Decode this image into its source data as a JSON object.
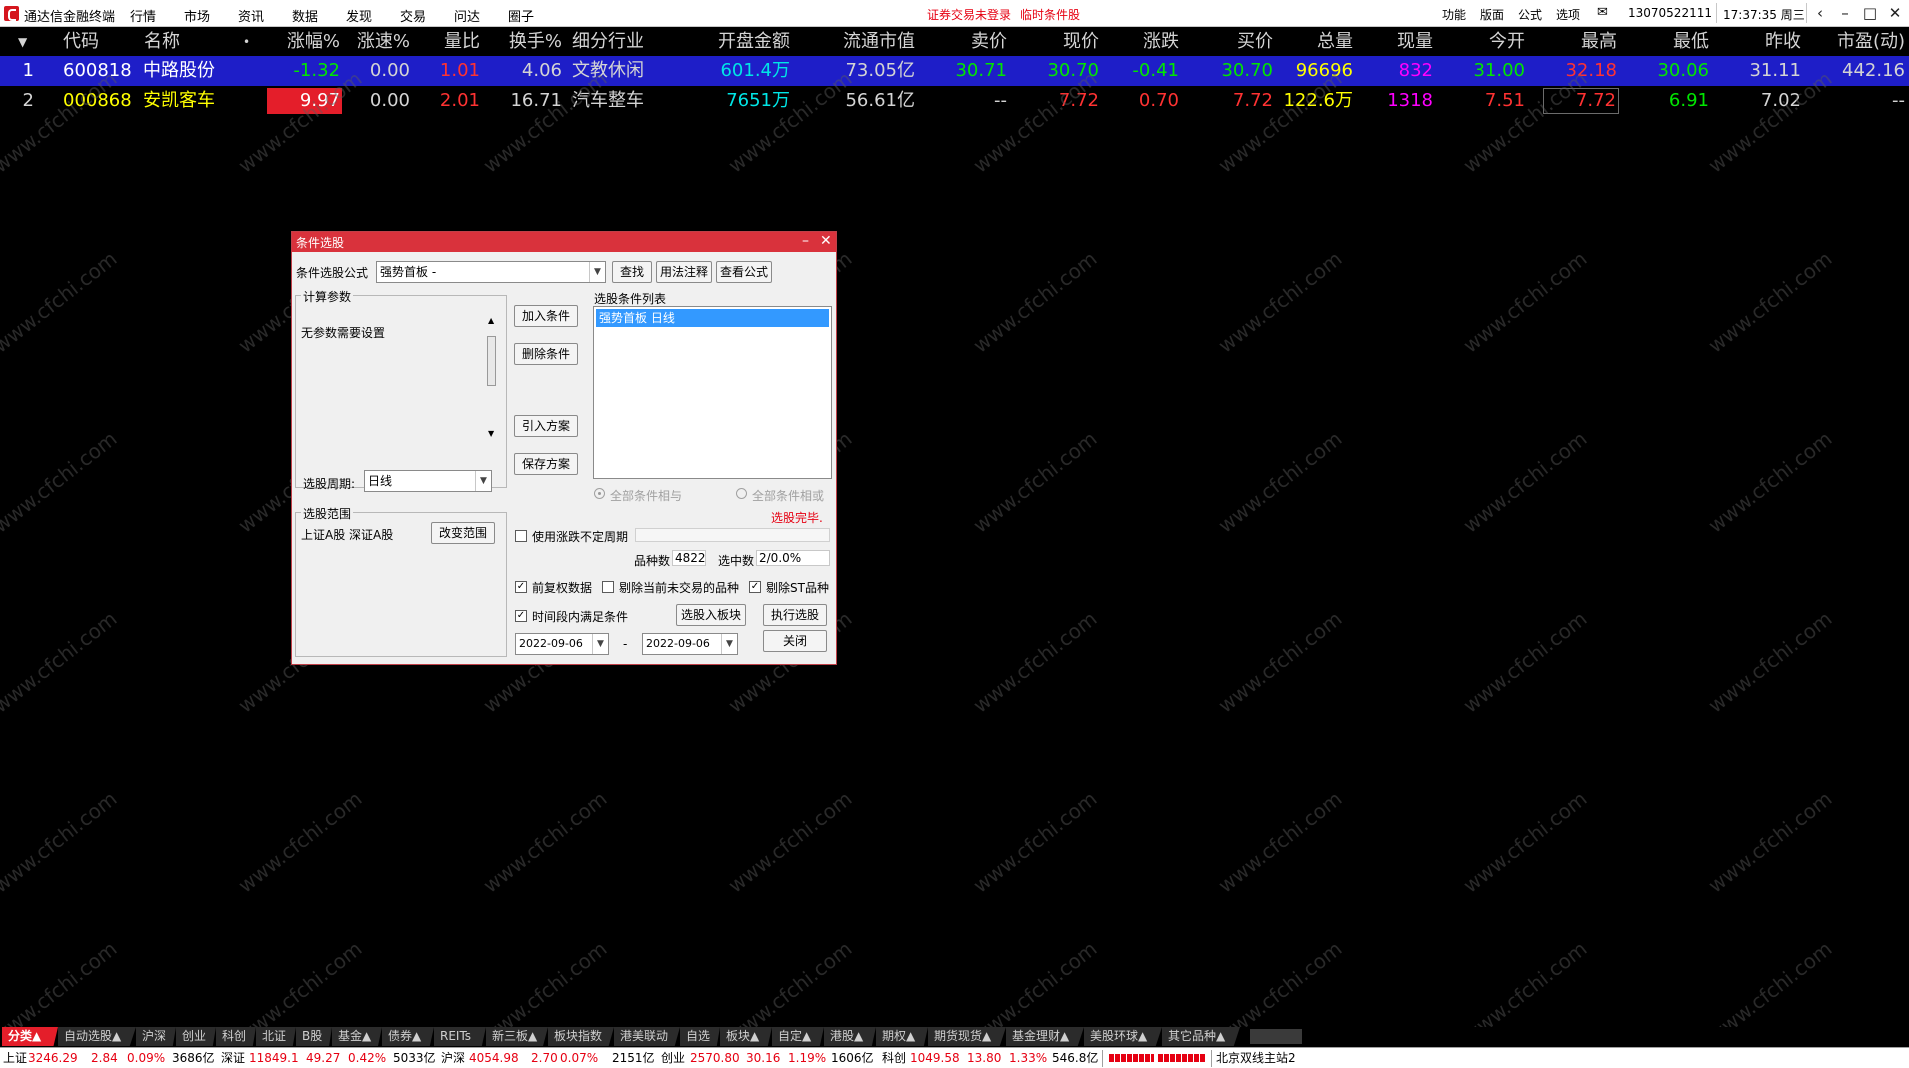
{
  "menubar": {
    "app_title": "通达信金融终端",
    "menus": [
      "行情",
      "市场",
      "资讯",
      "数据",
      "发现",
      "交易",
      "问达",
      "圈子"
    ],
    "notice_trade": "证券交易未登录",
    "notice_temp": "临时条件股",
    "right_items": [
      "功能",
      "版面",
      "公式",
      "选项"
    ],
    "account": "13070522111",
    "clock": "17:37:35 周三"
  },
  "table": {
    "headers": [
      "代码",
      "名称",
      "•",
      "涨幅%",
      "涨速%",
      "量比",
      "换手%",
      "细分行业",
      "开盘金额",
      "流通市值",
      "卖价",
      "现价",
      "涨跌",
      "买价",
      "总量",
      "现量",
      "今开",
      "最高",
      "最低",
      "昨收",
      "市盈(动)"
    ],
    "rows": [
      {
        "idx": "1",
        "code": "600818",
        "name": "中路股份",
        "chg_pct": "-1.32",
        "speed": "0.00",
        "vol_ratio": "1.01",
        "turnover": "4.06",
        "industry": "文教休闲",
        "open_amt": "601.4万",
        "float_cap": "73.05亿",
        "ask": "30.71",
        "price": "30.70",
        "chg": "-0.41",
        "bid": "30.70",
        "total_vol": "96696",
        "cur_vol": "832",
        "open": "31.00",
        "high": "32.18",
        "low": "30.06",
        "prev_close": "31.11",
        "pe": "442.16"
      },
      {
        "idx": "2",
        "code": "000868",
        "name": "安凯客车",
        "chg_pct": "9.97",
        "speed": "0.00",
        "vol_ratio": "2.01",
        "turnover": "16.71",
        "industry": "汽车整车",
        "open_amt": "7651万",
        "float_cap": "56.61亿",
        "ask": "--",
        "price": "7.72",
        "chg": "0.70",
        "bid": "7.72",
        "total_vol": "122.6万",
        "cur_vol": "1318",
        "open": "7.51",
        "high": "7.72",
        "low": "6.91",
        "prev_close": "7.02",
        "pe": "--"
      }
    ]
  },
  "watermark": "www.cfchi.com",
  "dialog": {
    "title": "条件选股",
    "formula_label": "条件选股公式",
    "formula_value": "强势首板    -",
    "find_btn": "查找",
    "usage_btn": "用法注释",
    "view_btn": "查看公式",
    "params_group": "计算参数",
    "no_params": "无参数需要设置",
    "period_label": "选股周期:",
    "period_value": "日线",
    "add_btn": "加入条件",
    "del_btn": "删除条件",
    "import_btn": "引入方案",
    "save_btn": "保存方案",
    "list_label": "选股条件列表",
    "list_items": [
      "强势首板  日线"
    ],
    "radio_and": "全部条件相与",
    "radio_or": "全部条件相或",
    "done": "选股完毕.",
    "scope_group": "选股范围",
    "scope_value": "上证A股 深证A股",
    "change_scope_btn": "改变范围",
    "use_period_label": "使用涨跌不定周期",
    "count_label": "品种数",
    "count_value": "4822",
    "hit_label": "选中数",
    "hit_value": "2/0.0%",
    "fq_label": "前复权数据",
    "exclude_untraded": "剔除当前未交易的品种",
    "exclude_st": "剔除ST品种",
    "time_range_label": "时间段内满足条件",
    "to_block_btn": "选股入板块",
    "exec_btn": "执行选股",
    "date_from": "2022-09-06",
    "date_sep": "-",
    "date_to": "2022-09-06",
    "close_btn": "关闭"
  },
  "tabs": [
    "分类▲",
    "自动选股▲",
    "沪深",
    "创业",
    "科创",
    "北证",
    "B股",
    "基金▲",
    "债券▲",
    "REITs",
    "新三板▲",
    "板块指数",
    "港美联动",
    "自选",
    "板块▲",
    "自定▲",
    "港股▲",
    "期权▲",
    "期货现货▲",
    "基金理财▲",
    "美股环球▲",
    "其它品种▲"
  ],
  "status": {
    "sh_label": "上证",
    "sh_val": "3246.29",
    "sh_chg": "2.84",
    "sh_pct": "0.09%",
    "sh_amt": "3686亿",
    "sz_label": "深证",
    "sz_val": "11849.1",
    "sz_chg": "49.27",
    "sz_pct": "0.42%",
    "sz_amt": "5033亿",
    "hs_label": "沪深",
    "hs_val": "4054.98",
    "hs_chg": "2.70",
    "hs_pct": "0.07%",
    "hs_amt": "2151亿",
    "cy_label": "创业",
    "cy_val": "2570.80",
    "cy_chg": "30.16",
    "cy_pct": "1.19%",
    "cy_amt": "1606亿",
    "kc_label": "科创",
    "kc_val": "1049.58",
    "kc_chg": "13.80",
    "kc_pct": "1.33%",
    "kc_amt": "546.8亿",
    "server": "北京双线主站2"
  }
}
